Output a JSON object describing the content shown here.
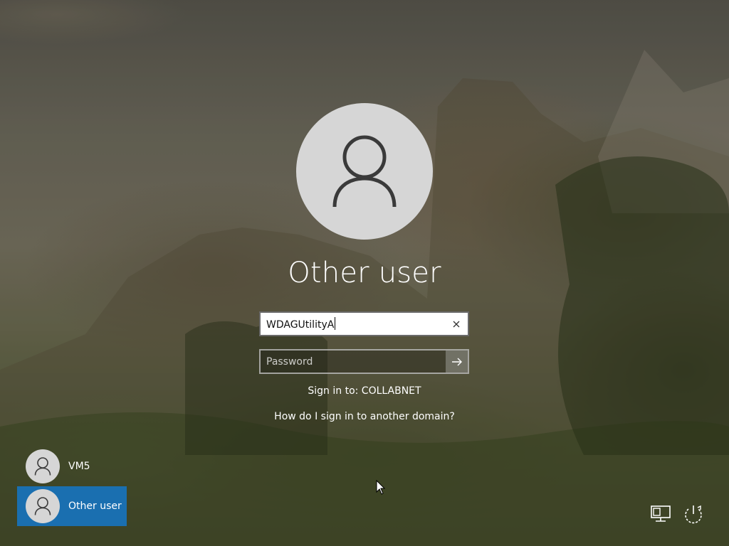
{
  "login": {
    "user_title": "Other user",
    "username_value": "WDAGUtilityA",
    "password_placeholder": "Password",
    "sign_in_to": "Sign in to: COLLABNET",
    "other_domain_link": "How do I sign in to another domain?"
  },
  "user_list": [
    {
      "name": "VM5",
      "selected": false
    },
    {
      "name": "Other user",
      "selected": true
    }
  ],
  "tray": {
    "network_icon": "network-icon",
    "power_icon": "power-icon"
  },
  "colors": {
    "selected_user_bg": "#1a6fb0",
    "avatar_bg": "#d6d6d6"
  }
}
